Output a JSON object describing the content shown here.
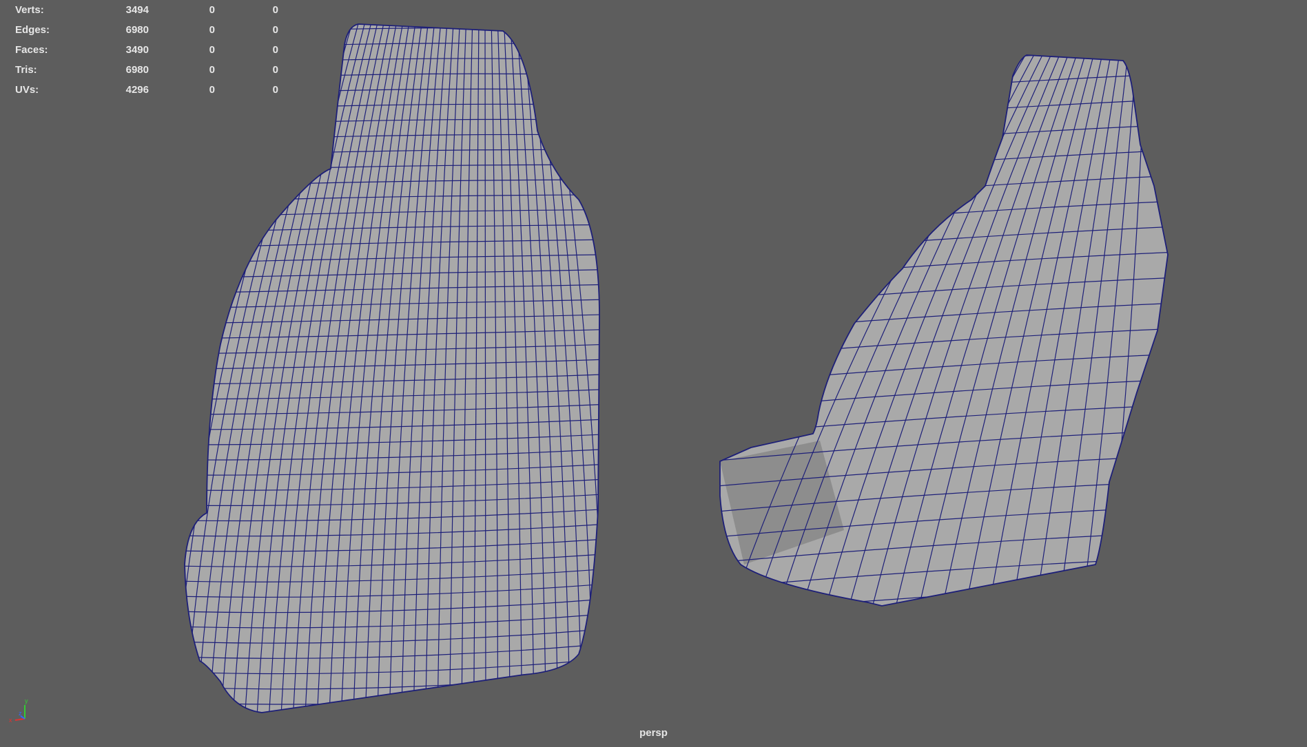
{
  "hud": {
    "rows": [
      {
        "label": "Verts:",
        "value": "3494",
        "selected": "0",
        "uv": "0"
      },
      {
        "label": "Edges:",
        "value": "6980",
        "selected": "0",
        "uv": "0"
      },
      {
        "label": "Faces:",
        "value": "3490",
        "selected": "0",
        "uv": "0"
      },
      {
        "label": "Tris:",
        "value": "6980",
        "selected": "0",
        "uv": "0"
      },
      {
        "label": "UVs:",
        "value": "4296",
        "selected": "0",
        "uv": "0"
      }
    ]
  },
  "viewport": {
    "camera": "persp",
    "background": "#5d5d5d",
    "mesh_color": "#a9a9a9",
    "wire_color": "#1d1f78"
  },
  "axis": {
    "x": "x",
    "y": "y",
    "z": "z"
  }
}
